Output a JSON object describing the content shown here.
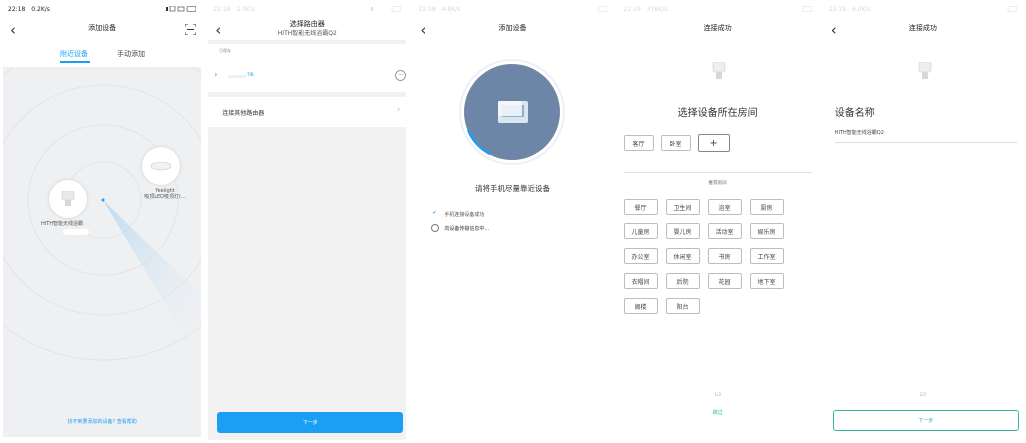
{
  "s1": {
    "time": "22:18",
    "speed": "0.2K/s",
    "title": "添加设备",
    "tab_nearby": "附近设备",
    "tab_manual": "手动添加",
    "device_a_label": "HITH智能无线浴霸",
    "device_b_name": "Yeelight",
    "device_b_label": "吸顶LED吸顶灯(...",
    "help_link": "找不到要添加的设备? 查看帮助",
    "colors": {
      "accent": "#1a9ff5"
    }
  },
  "s2": {
    "time": "22:18",
    "speed": "2.0K/s",
    "title": "选择路由器",
    "subtitle": "HITH智能无线浴霸Q2",
    "section_label": "已保存",
    "router_suffix": "-TIB",
    "other_router": "连接其他路由器",
    "next": "下一步"
  },
  "s3": {
    "time": "22:18",
    "speed": "4.8K/s",
    "title": "添加设备",
    "hint": "请将手机尽量靠近设备",
    "step1": "手机连接设备成功",
    "step2": "向设备传输信息中..."
  },
  "s4": {
    "time": "22:19",
    "speed": "376K/s",
    "title": "连接成功",
    "heading": "选择设备所在房间",
    "rooms": [
      "客厅",
      "卧室"
    ],
    "add_symbol": "+",
    "recommend_label": "推荐房间",
    "recommended": [
      "餐厅",
      "卫生间",
      "浴室",
      "厨房",
      "儿童房",
      "婴儿房",
      "活动室",
      "娱乐房",
      "办公室",
      "休闲室",
      "书房",
      "工作室",
      "衣帽间",
      "后院",
      "花园",
      "地下室",
      "阁楼",
      "阳台"
    ],
    "page": "1/3",
    "skip": "跳过"
  },
  "s5": {
    "time": "22:19",
    "speed": "6.0K/s",
    "title": "连接成功",
    "heading": "设备名称",
    "device_name": "HITH智能无线浴霸Q2",
    "page": "2/3",
    "next": "下一步"
  }
}
